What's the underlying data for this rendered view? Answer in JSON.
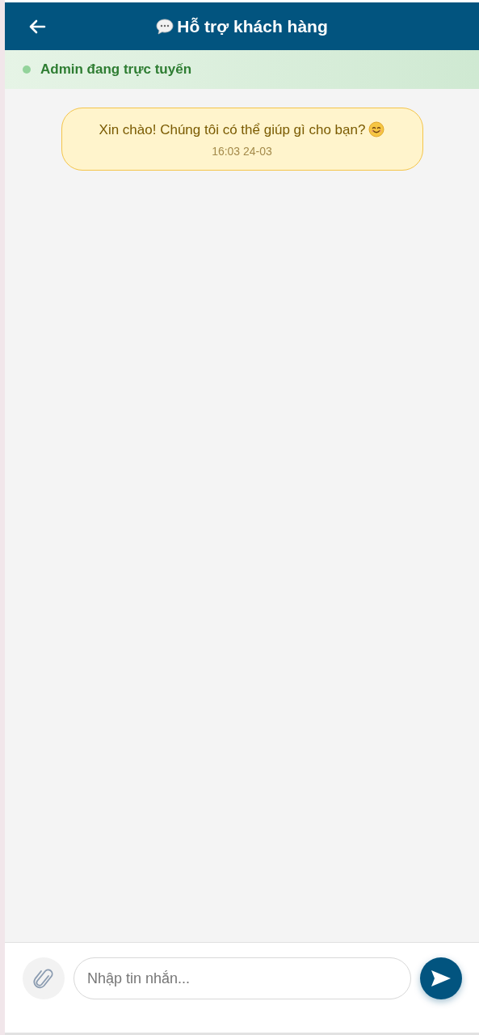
{
  "header": {
    "title": "Hỗ trợ khách hàng"
  },
  "status": {
    "text": "Admin đang trực tuyến",
    "online": true
  },
  "messages": [
    {
      "text": "Xin chào! Chúng tôi có thể giúp gì cho bạn?",
      "time": "16:03 24-03",
      "kind": "incoming",
      "emoji": true
    }
  ],
  "composer": {
    "placeholder": "Nhập tin nhắn..."
  }
}
